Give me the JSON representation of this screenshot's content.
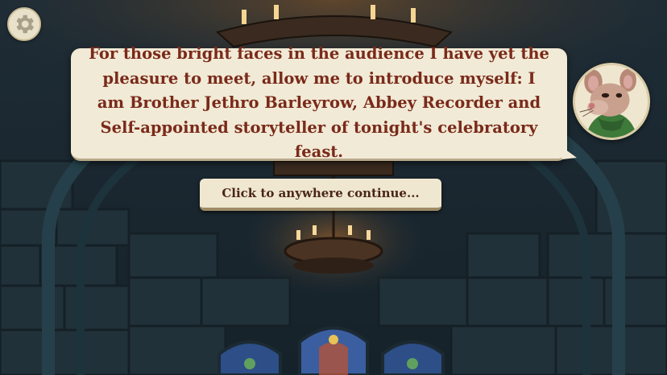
{
  "dialog": {
    "text": "For those bright faces in the audience I have yet the pleasure to meet, allow me to introduce myself: I am Brother Jethro Barleyrow, Abbey Recorder and Self-appointed storyteller of tonight's celebratory feast."
  },
  "actions": {
    "continue_label": "Click to anywhere continue..."
  },
  "icons": {
    "settings": "gear-icon",
    "speaker": "mouse-portrait"
  },
  "colors": {
    "dialog_bg": "#f1ead6",
    "dialog_text": "#7a2a1a",
    "button_text": "#4a2616"
  }
}
